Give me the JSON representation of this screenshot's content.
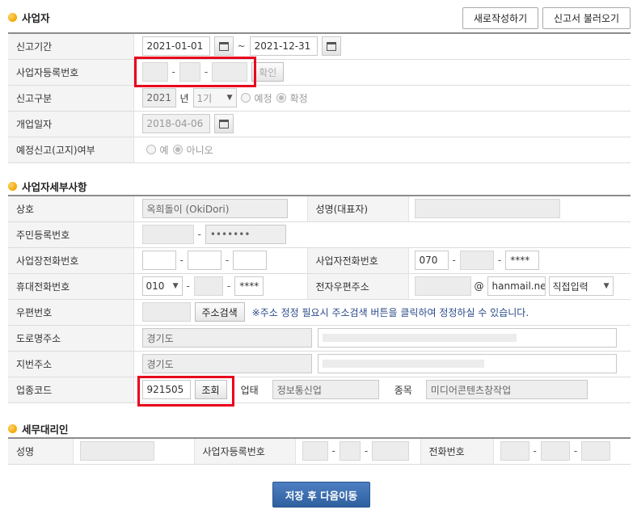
{
  "sections": {
    "business": "사업자",
    "detail": "사업자세부사항",
    "agent": "세무대리인"
  },
  "top_buttons": {
    "new": "새로작성하기",
    "load": "신고서 불러오기"
  },
  "business": {
    "period_label": "신고기간",
    "period_start": "2021-01-01",
    "period_tilde": "~",
    "period_end": "2021-12-31",
    "regno_label": "사업자등록번호",
    "confirm": "확인",
    "type_label": "신고구분",
    "year": "2021",
    "year_unit": "년",
    "term": "1기",
    "opt_scheduled": "예정",
    "opt_final": "확정",
    "open_label": "개업일자",
    "open_date": "2018-04-06",
    "notice_label": "예정신고(고지)여부",
    "opt_yes": "예",
    "opt_no": "아니오"
  },
  "detail": {
    "trade_label": "상호",
    "trade_name": "옥희돌이 (OkiDori)",
    "rep_label": "성명(대표자)",
    "rrn_label": "주민등록번호",
    "rrn_back": "•••••••",
    "site_phone_label": "사업장전화번호",
    "biz_phone_label": "사업자전화번호",
    "biz_phone_1": "070",
    "biz_phone_3": "****",
    "mobile_label": "휴대전화번호",
    "mobile_1": "010",
    "mobile_3": "****",
    "email_label": "전자우편주소",
    "email_at": "@",
    "email_domain": "hanmail.ne",
    "email_select": "직접입력",
    "zip_label": "우편번호",
    "zip_button": "주소검색",
    "zip_note": "※주소 정정 필요시 주소검색 버튼을 클릭하여 정정하실 수 있습니다.",
    "road_label": "도로명주소",
    "road_prefix": "경기도",
    "lot_label": "지번주소",
    "lot_prefix": "경기도",
    "industry_label": "업종코드",
    "industry_code": "921505",
    "lookup": "조회",
    "sector_label": "업태",
    "sector": "정보통신업",
    "item_label": "종목",
    "item": "미디어콘텐츠창작업"
  },
  "agent": {
    "name_label": "성명",
    "regno_label": "사업자등록번호",
    "phone_label": "전화번호"
  },
  "save_button": "저장 후 다음이동"
}
